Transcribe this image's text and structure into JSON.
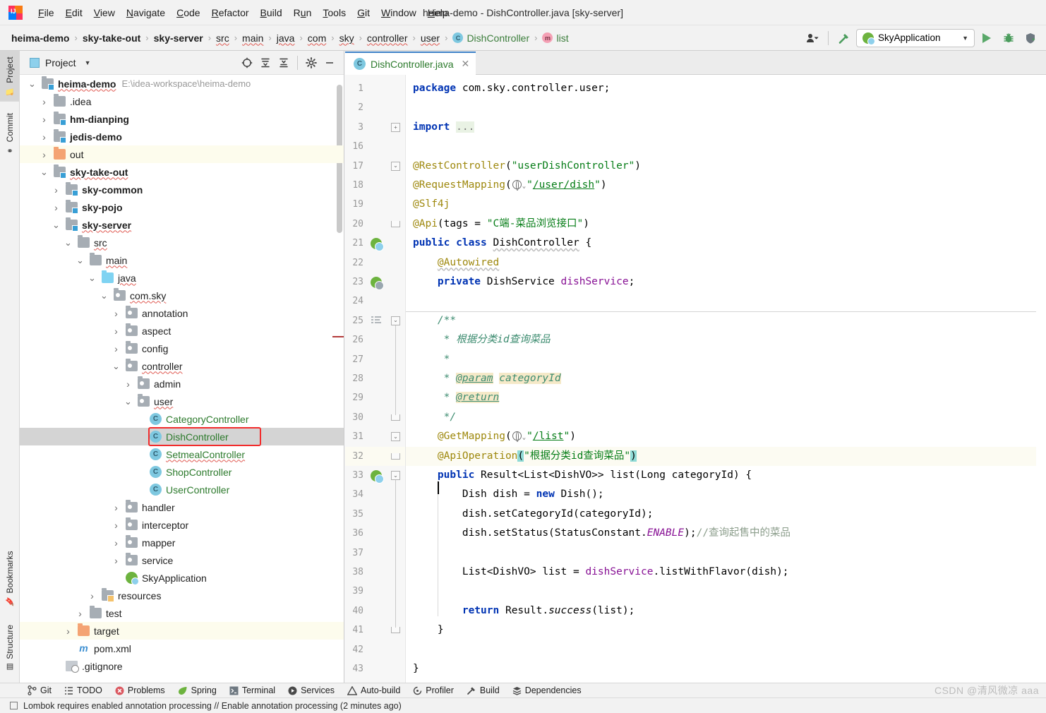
{
  "window": {
    "title": "heima-demo - DishController.java [sky-server]"
  },
  "menu": {
    "items": [
      "File",
      "Edit",
      "View",
      "Navigate",
      "Code",
      "Refactor",
      "Build",
      "Run",
      "Tools",
      "Git",
      "Window",
      "Help"
    ]
  },
  "navbar": {
    "crumbs": [
      {
        "label": "heima-demo",
        "style": "bold"
      },
      {
        "label": "sky-take-out",
        "style": "bold"
      },
      {
        "label": "sky-server",
        "style": "bold"
      },
      {
        "label": "src",
        "style": "squig"
      },
      {
        "label": "main",
        "style": "squig"
      },
      {
        "label": "java",
        "style": "squig"
      },
      {
        "label": "com",
        "style": "squig"
      },
      {
        "label": "sky",
        "style": "squig"
      },
      {
        "label": "controller",
        "style": "squig"
      },
      {
        "label": "user",
        "style": "squig"
      },
      {
        "label": "DishController",
        "style": "class"
      },
      {
        "label": "list",
        "style": "method"
      }
    ],
    "separator": "›",
    "run_config": "SkyApplication",
    "run_config_caret": "▼",
    "icons": {
      "user": "user-settings-icon",
      "hammer": "build-hammer-icon",
      "run": "run-icon",
      "debug": "debug-icon",
      "coverage": "run-with-coverage-icon"
    }
  },
  "left_strip": {
    "tabs": [
      {
        "label": "Project",
        "active": true,
        "icon": "project-folder-icon"
      },
      {
        "label": "Commit",
        "active": false,
        "icon": "commit-icon"
      },
      {
        "label": "Bookmarks",
        "active": false,
        "icon": "bookmark-icon"
      },
      {
        "label": "Structure",
        "active": false,
        "icon": "structure-icon"
      }
    ]
  },
  "project_panel": {
    "title": "Project",
    "chevron": "▼",
    "toolbar_icons": [
      "locate-icon",
      "expand-all-icon",
      "collapse-all-icon",
      "settings-gear-icon",
      "hide-minimize-icon"
    ],
    "tree": [
      {
        "label": "heima-demo",
        "path": "E:\\idea-workspace\\heima-demo",
        "depth": 0,
        "arrow": "down",
        "icon": "module",
        "bold": true,
        "squig": true
      },
      {
        "label": ".idea",
        "depth": 1,
        "arrow": "right",
        "icon": "folder"
      },
      {
        "label": "hm-dianping",
        "depth": 1,
        "arrow": "right",
        "icon": "module",
        "bold": true
      },
      {
        "label": "jedis-demo",
        "depth": 1,
        "arrow": "right",
        "icon": "module",
        "bold": true
      },
      {
        "label": "out",
        "depth": 1,
        "arrow": "right",
        "icon": "excluded",
        "highlight": "yellow"
      },
      {
        "label": "sky-take-out",
        "depth": 1,
        "arrow": "down",
        "icon": "module",
        "bold": true,
        "squig": true
      },
      {
        "label": "sky-common",
        "depth": 2,
        "arrow": "right",
        "icon": "module",
        "bold": true
      },
      {
        "label": "sky-pojo",
        "depth": 2,
        "arrow": "right",
        "icon": "module",
        "bold": true
      },
      {
        "label": "sky-server",
        "depth": 2,
        "arrow": "down",
        "icon": "module",
        "bold": true,
        "squig": true
      },
      {
        "label": "src",
        "depth": 3,
        "arrow": "down",
        "icon": "folder",
        "squig": true
      },
      {
        "label": "main",
        "depth": 4,
        "arrow": "down",
        "icon": "folder",
        "squig": true
      },
      {
        "label": "java",
        "depth": 5,
        "arrow": "down",
        "icon": "source",
        "squig": true
      },
      {
        "label": "com.sky",
        "depth": 6,
        "arrow": "down",
        "icon": "package",
        "squig": true
      },
      {
        "label": "annotation",
        "depth": 7,
        "arrow": "right",
        "icon": "package"
      },
      {
        "label": "aspect",
        "depth": 7,
        "arrow": "right",
        "icon": "package"
      },
      {
        "label": "config",
        "depth": 7,
        "arrow": "right",
        "icon": "package"
      },
      {
        "label": "controller",
        "depth": 7,
        "arrow": "down",
        "icon": "package",
        "squig": true
      },
      {
        "label": "admin",
        "depth": 8,
        "arrow": "right",
        "icon": "package"
      },
      {
        "label": "user",
        "depth": 8,
        "arrow": "down",
        "icon": "package",
        "squig": true
      },
      {
        "label": "CategoryController",
        "depth": 9,
        "arrow": "none",
        "icon": "class",
        "green": true
      },
      {
        "label": "DishController",
        "depth": 9,
        "arrow": "none",
        "icon": "class",
        "green": true,
        "selected": true,
        "redbox": true
      },
      {
        "label": "SetmealController",
        "depth": 9,
        "arrow": "none",
        "icon": "class",
        "green": true,
        "squig": true
      },
      {
        "label": "ShopController",
        "depth": 9,
        "arrow": "none",
        "icon": "class",
        "green": true
      },
      {
        "label": "UserController",
        "depth": 9,
        "arrow": "none",
        "icon": "class",
        "green": true
      },
      {
        "label": "handler",
        "depth": 7,
        "arrow": "right",
        "icon": "package"
      },
      {
        "label": "interceptor",
        "depth": 7,
        "arrow": "right",
        "icon": "package"
      },
      {
        "label": "mapper",
        "depth": 7,
        "arrow": "right",
        "icon": "package"
      },
      {
        "label": "service",
        "depth": 7,
        "arrow": "right",
        "icon": "package"
      },
      {
        "label": "SkyApplication",
        "depth": 7,
        "arrow": "none",
        "icon": "spring"
      },
      {
        "label": "resources",
        "depth": 5,
        "arrow": "right",
        "icon": "resources"
      },
      {
        "label": "test",
        "depth": 4,
        "arrow": "right",
        "icon": "folder"
      },
      {
        "label": "target",
        "depth": 3,
        "arrow": "right",
        "icon": "excluded",
        "highlight": "yellow"
      },
      {
        "label": "pom.xml",
        "depth": 3,
        "arrow": "none",
        "icon": "maven"
      },
      {
        "label": ".gitignore",
        "depth": 2,
        "arrow": "none",
        "icon": "gitignore"
      }
    ]
  },
  "editor": {
    "tab": {
      "filename": "DishController.java",
      "close": "✕",
      "icon": "java-class-icon"
    },
    "line_numbers": [
      1,
      2,
      3,
      16,
      17,
      18,
      19,
      20,
      21,
      22,
      23,
      24,
      25,
      26,
      27,
      28,
      29,
      30,
      31,
      32,
      33,
      34,
      35,
      36,
      37,
      38,
      39,
      40,
      41,
      42,
      43
    ],
    "code_lines": [
      "package com.sky.controller.user;",
      "",
      "import ...",
      "",
      "@RestController(\"userDishController\")",
      "@RequestMapping(\"/user/dish\")",
      "@Slf4j",
      "@Api(tags = \"C端-菜品浏览接口\")",
      "public class DishController {",
      "    @Autowired",
      "    private DishService dishService;",
      "",
      "    /**",
      "     * 根据分类id查询菜品",
      "     *",
      "     * @param categoryId",
      "     * @return",
      "     */",
      "    @GetMapping(\"/list\")",
      "    @ApiOperation(\"根据分类id查询菜品\")",
      "    public Result<List<DishVO>> list(Long categoryId) {",
      "        Dish dish = new Dish();",
      "        dish.setCategoryId(categoryId);",
      "        dish.setStatus(StatusConstant.ENABLE);//查询起售中的菜品",
      "",
      "        List<DishVO> list = dishService.listWithFlavor(dish);",
      "",
      "        return Result.success(list);",
      "    }",
      "",
      "}"
    ],
    "gutter_icons": [
      {
        "line": 21,
        "name": "spring-bean-icon"
      },
      {
        "line": 23,
        "name": "spring-autowired-icon"
      },
      {
        "line": 25,
        "name": "javadoc-icon"
      },
      {
        "line": 33,
        "name": "spring-mapping-icon"
      }
    ],
    "highlighted_line": 32
  },
  "tool_windows": {
    "items": [
      {
        "label": "Git",
        "icon": "git-branch-icon"
      },
      {
        "label": "TODO",
        "icon": "todo-list-icon"
      },
      {
        "label": "Problems",
        "icon": "problems-error-icon"
      },
      {
        "label": "Spring",
        "icon": "spring-leaf-icon"
      },
      {
        "label": "Terminal",
        "icon": "terminal-icon"
      },
      {
        "label": "Services",
        "icon": "services-play-icon"
      },
      {
        "label": "Auto-build",
        "icon": "auto-build-warning-icon"
      },
      {
        "label": "Profiler",
        "icon": "profiler-icon"
      },
      {
        "label": "Build",
        "icon": "build-hammer-icon"
      },
      {
        "label": "Dependencies",
        "icon": "dependencies-icon"
      }
    ]
  },
  "status_bar": {
    "message": "Lombok requires enabled annotation processing // Enable annotation processing (2 minutes ago)",
    "checkbox": "unchecked"
  },
  "watermark": "CSDN @清风微凉 aaa",
  "colors": {
    "accent_blue": "#4083c9",
    "spring_green": "#6db33f",
    "redbox": "#f22c2c",
    "selection": "#d4d4d4",
    "yellow_row": "#fdfced",
    "keyword": "#0033b3",
    "string": "#067d17",
    "annotation": "#9e880d",
    "field": "#871094",
    "javadoc": "#3d8c70"
  }
}
